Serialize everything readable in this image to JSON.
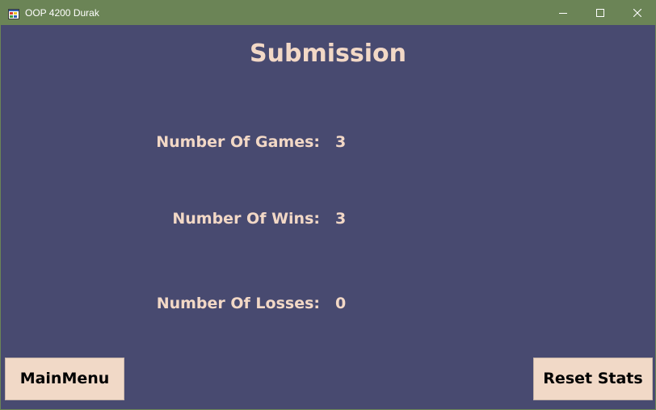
{
  "window": {
    "title": "OOP 4200 Durak"
  },
  "main": {
    "heading": "Submission",
    "stats": {
      "games_label": "Number Of Games:",
      "games_value": "3",
      "wins_label": "Number Of Wins:",
      "wins_value": "3",
      "losses_label": "Number Of Losses:",
      "losses_value": "0"
    }
  },
  "buttons": {
    "main_menu": "MainMenu",
    "reset_stats": "Reset Stats"
  },
  "icons": {
    "app": "app-window-icon",
    "minimize": "minimize-icon",
    "maximize": "maximize-icon",
    "close": "close-icon"
  },
  "colors": {
    "titlebar": "#6b8456",
    "background": "#484a70",
    "text": "#f2d8c6",
    "button": "#f1d9c7"
  }
}
